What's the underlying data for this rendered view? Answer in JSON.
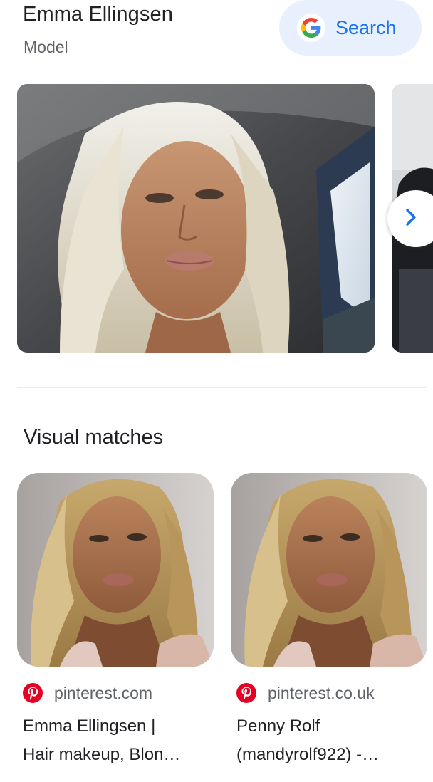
{
  "entity": {
    "title": "Emma Ellingsen",
    "subtitle": "Model"
  },
  "search_button": {
    "label": "Search",
    "icon": "google-g-icon"
  },
  "carousel": {
    "images": [
      {
        "name": "carousel-image-1"
      },
      {
        "name": "carousel-image-2"
      }
    ],
    "next_icon": "chevron-right-icon"
  },
  "visual_matches": {
    "heading": "Visual matches",
    "items": [
      {
        "source": "pinterest.com",
        "title_line1": "Emma Ellingsen |",
        "title_line2": "Hair makeup, Blon…",
        "source_icon": "pinterest-icon"
      },
      {
        "source": "pinterest.co.uk",
        "title_line1": "Penny Rolf",
        "title_line2": "(mandyrolf922) -…",
        "source_icon": "pinterest-icon"
      }
    ]
  },
  "colors": {
    "accent": "#1a73e8",
    "search_bg": "#e8f0fe",
    "pinterest": "#e60023",
    "text_primary": "#202124",
    "text_secondary": "#5f6368"
  }
}
